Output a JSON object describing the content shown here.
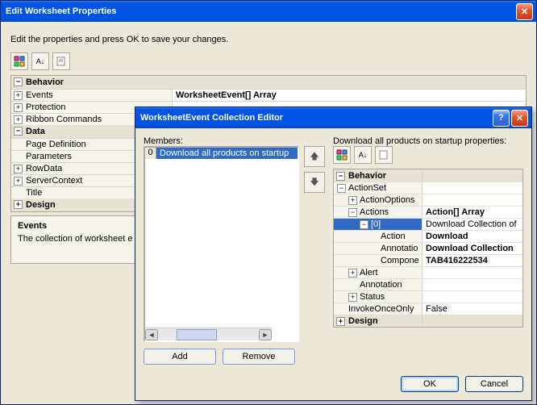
{
  "outer": {
    "title": "Edit Worksheet Properties",
    "instruction": "Edit the properties and press OK to save your changes.",
    "categories": {
      "behavior": "Behavior",
      "data": "Data",
      "design": "Design"
    },
    "rows": {
      "events": "Events",
      "protection": "Protection",
      "ribbon": "Ribbon Commands",
      "pagedef": "Page Definition",
      "params": "Parameters",
      "rowdata": "RowData",
      "serverctx": "ServerContext",
      "title": "Title"
    },
    "events_value": "WorksheetEvent[] Array",
    "footer_title": "Events",
    "footer_text": "The collection of worksheet e"
  },
  "inner": {
    "title": "WorksheetEvent Collection Editor",
    "members_label": "Members:",
    "props_label": "Download all products on startup properties:",
    "member_index": "0",
    "member_name": "Download all products on startup",
    "add_label": "Add",
    "remove_label": "Remove",
    "ok_label": "OK",
    "cancel_label": "Cancel",
    "propgrid": {
      "behavior": "Behavior",
      "actionset": "ActionSet",
      "actionoptions": "ActionOptions",
      "actions": "Actions",
      "actions_val": "Action[] Array",
      "idx0": "[0]",
      "idx0_val": "Download Collection of",
      "action": "Action",
      "action_val": "Download",
      "annotation_row": "Annotatio",
      "annotation_val": "Download Collection",
      "component": "Compone",
      "component_val": "TAB416222534",
      "alert": "Alert",
      "annotation": "Annotation",
      "status": "Status",
      "invoke": "InvokeOnceOnly",
      "invoke_val": "False",
      "design": "Design"
    }
  }
}
